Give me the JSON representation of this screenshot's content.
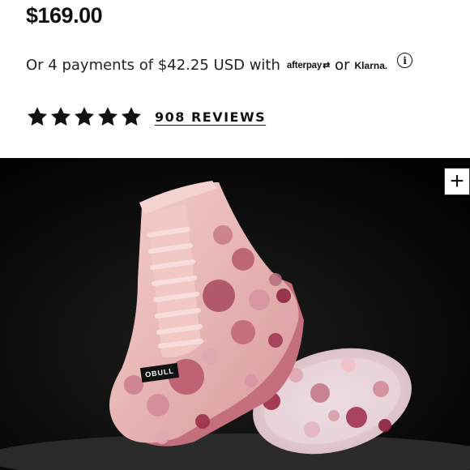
{
  "product": {
    "price": "$169.00",
    "payments": {
      "prefix": "Or 4 payments of $42.25 USD with",
      "afterpay": "afterpay",
      "or": "or",
      "klarna": "Klarna.",
      "info_icon": "info-icon"
    },
    "rating": {
      "stars": 5,
      "max": 5,
      "reviews_label": "908 REVIEWS"
    },
    "image": {
      "shoe_logo_text": "OBULL",
      "zoom_label": "+"
    }
  }
}
